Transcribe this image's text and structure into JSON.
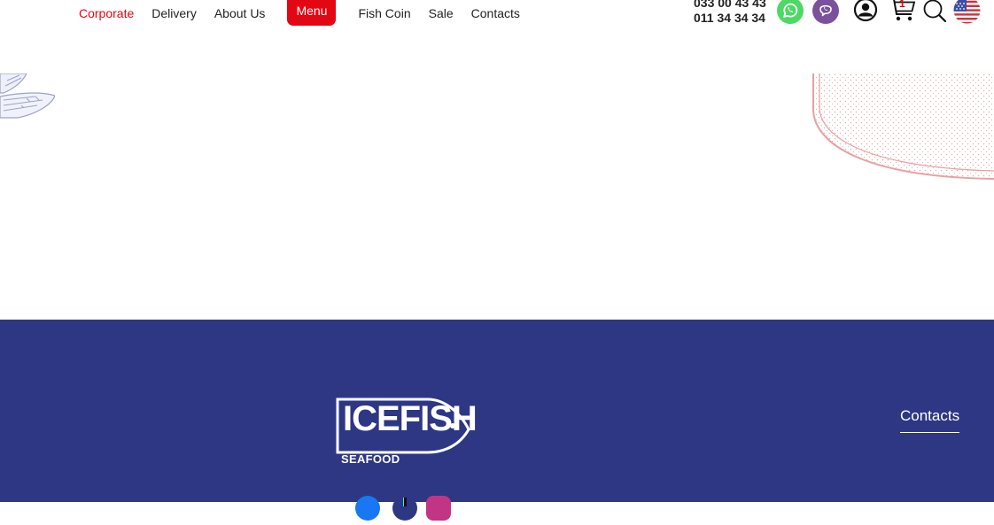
{
  "nav": {
    "items": [
      {
        "label": "Corporate",
        "state": "active"
      },
      {
        "label": "Delivery"
      },
      {
        "label": "About Us"
      },
      {
        "label": "Menu",
        "state": "highlighted"
      },
      {
        "label": "Fish Coin"
      },
      {
        "label": "Sale"
      },
      {
        "label": "Contacts"
      }
    ]
  },
  "header": {
    "phones": [
      "033 00 43 43",
      "011 34 34 34"
    ],
    "cart_count": "1",
    "icons": [
      "whatsapp-icon",
      "viber-icon",
      "user-icon",
      "cart-icon",
      "search-icon",
      "us-flag-icon"
    ]
  },
  "footer": {
    "logo_main": "ICEFISH",
    "logo_sub": "SEAFOOD",
    "contacts_label": "Contacts",
    "social": [
      "facebook-icon",
      "tiktok-icon",
      "instagram-icon"
    ]
  },
  "colors": {
    "accent": "#e30613",
    "footer_bg": "#2e3784",
    "whatsapp": "#4cd964",
    "viber": "#7b519d",
    "deco_blue": "#9aa3c9",
    "deco_pink": "#e8a0a0"
  }
}
